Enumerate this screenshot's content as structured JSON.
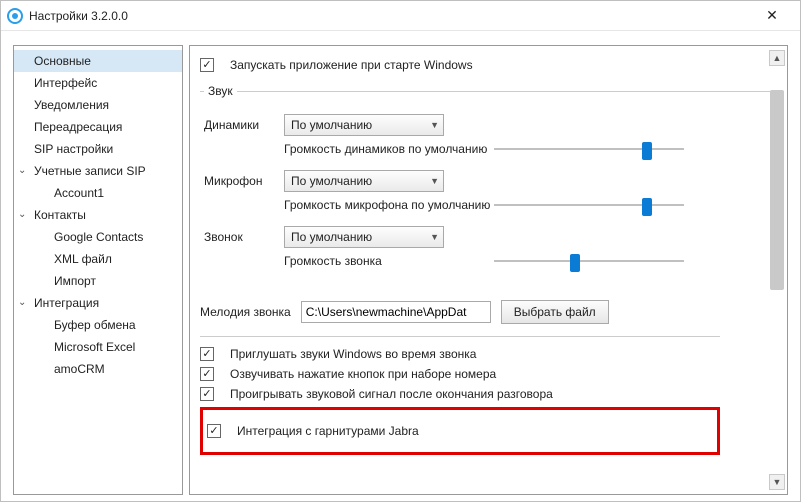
{
  "window": {
    "title": "Настройки 3.2.0.0"
  },
  "sidebar": {
    "items": [
      {
        "label": "Основные",
        "selected": true,
        "expandable": false
      },
      {
        "label": "Интерфейс",
        "selected": false,
        "expandable": false
      },
      {
        "label": "Уведомления",
        "selected": false,
        "expandable": false
      },
      {
        "label": "Переадресация",
        "selected": false,
        "expandable": false
      },
      {
        "label": "SIP настройки",
        "selected": false,
        "expandable": false
      },
      {
        "label": "Учетные записи SIP",
        "selected": false,
        "expandable": true
      },
      {
        "label": "Account1",
        "selected": false,
        "child": true
      },
      {
        "label": "Контакты",
        "selected": false,
        "expandable": true
      },
      {
        "label": "Google Contacts",
        "selected": false,
        "child": true
      },
      {
        "label": "XML файл",
        "selected": false,
        "child": true
      },
      {
        "label": "Импорт",
        "selected": false,
        "child": true
      },
      {
        "label": "Интеграция",
        "selected": false,
        "expandable": true
      },
      {
        "label": "Буфер обмена",
        "selected": false,
        "child": true
      },
      {
        "label": "Microsoft Excel",
        "selected": false,
        "child": true
      },
      {
        "label": "amoCRM",
        "selected": false,
        "child": true
      }
    ]
  },
  "main": {
    "run_on_startup": {
      "label": "Запускать приложение при старте Windows",
      "checked": true
    },
    "sound": {
      "legend": "Звук",
      "speakers": {
        "label": "Динамики",
        "value": "По умолчанию",
        "volume_label": "Громкость динамиков по умолчанию",
        "volume_pos": 0.78
      },
      "microphone": {
        "label": "Микрофон",
        "value": "По умолчанию",
        "volume_label": "Громкость микрофона по умолчанию",
        "volume_pos": 0.78
      },
      "ring": {
        "label": "Звонок",
        "value": "По умолчанию",
        "volume_label": "Громкость звонка",
        "volume_pos": 0.4
      }
    },
    "ringtone": {
      "label": "Мелодия звонка",
      "path": "C:\\Users\\newmachine\\AppDat",
      "button": "Выбрать файл"
    },
    "checks": [
      {
        "label": "Приглушать звуки Windows во время звонка",
        "checked": true
      },
      {
        "label": "Озвучивать нажатие кнопок при наборе номера",
        "checked": true
      },
      {
        "label": "Проигрывать звуковой сигнал после окончания разговора",
        "checked": true
      }
    ],
    "jabra": {
      "label": "Интеграция с гарнитурами Jabra",
      "checked": true
    }
  }
}
